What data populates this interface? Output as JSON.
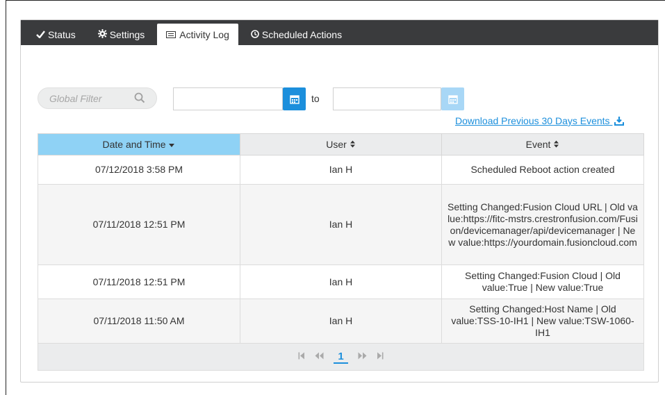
{
  "tabs": [
    {
      "label": "Status",
      "icon": "check-icon",
      "active": false
    },
    {
      "label": "Settings",
      "icon": "gear-icon",
      "active": false
    },
    {
      "label": "Activity Log",
      "icon": "list-icon",
      "active": true
    },
    {
      "label": "Scheduled Actions",
      "icon": "clock-icon",
      "active": false
    }
  ],
  "filter": {
    "global_placeholder": "Global Filter",
    "to_label": "to",
    "from_value": "",
    "to_value": ""
  },
  "download_label": "Download Previous 30 Days Events",
  "table": {
    "headers": [
      "Date and Time",
      "User",
      "Event"
    ],
    "rows": [
      {
        "datetime": "07/12/2018 3:58 PM",
        "user": "Ian H",
        "event": "Scheduled Reboot action created"
      },
      {
        "datetime": "07/11/2018 12:51 PM",
        "user": "Ian H",
        "event": "Setting Changed:Fusion Cloud URL | Old value:https://fitc-mstrs.crestronfusion.com/Fusion/devicemanager/api/devicemanager | New value:https://yourdomain.fusioncloud.com"
      },
      {
        "datetime": "07/11/2018 12:51 PM",
        "user": "Ian H",
        "event": "Setting Changed:Fusion Cloud | Old value:True | New value:True"
      },
      {
        "datetime": "07/11/2018 11:50 AM",
        "user": "Ian H",
        "event": "Setting Changed:Host Name | Old value:TSS-10-IH1 | New value:TSW-1060-IH1"
      }
    ]
  },
  "pagination": {
    "current_page": "1"
  },
  "colors": {
    "accent": "#1c8fdc",
    "tabbar": "#3a3b3d",
    "sorted_header": "#8fd2f5"
  }
}
